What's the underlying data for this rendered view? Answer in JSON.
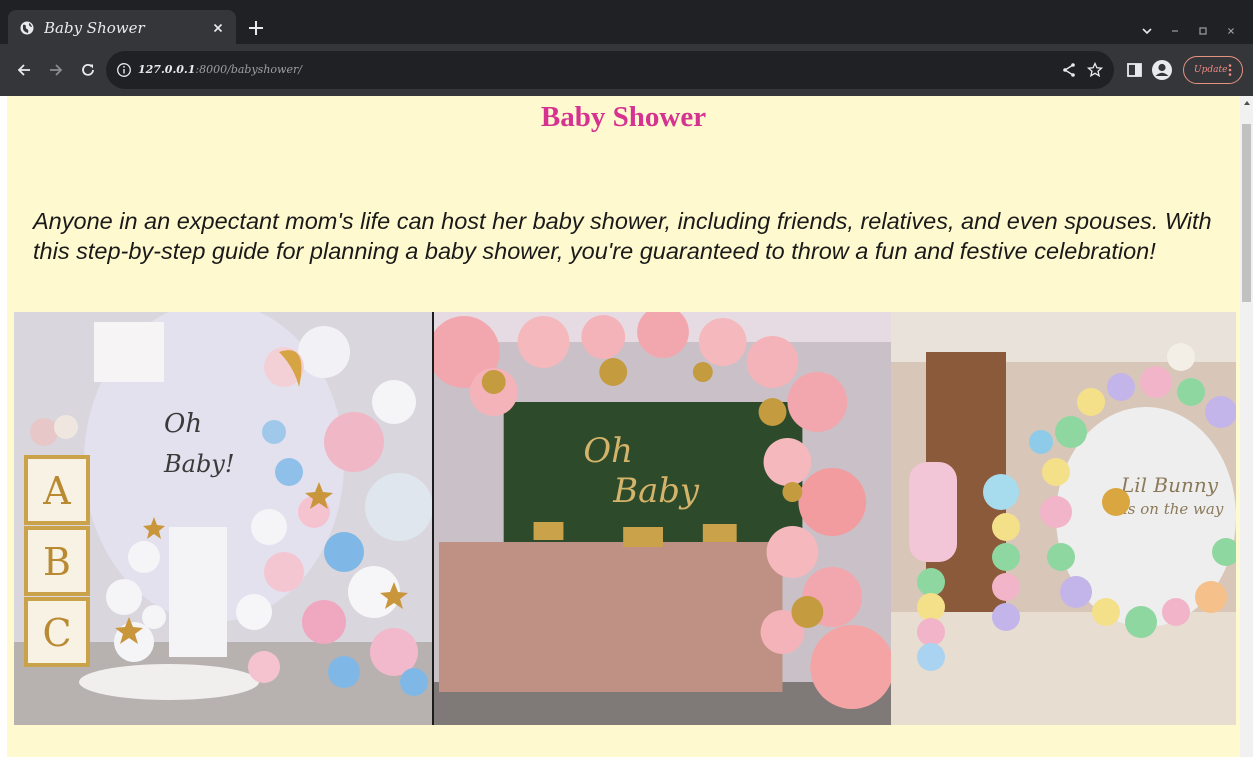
{
  "browser": {
    "tab_title": "Baby Shower",
    "url_host": "127.0.0.1",
    "url_rest": ":8000/babyshower/",
    "update_label": "Update"
  },
  "page": {
    "title": "Baby Shower",
    "intro": "Anyone in an expectant mom's life can host her baby shower, including friends, relatives, and even spouses. With this step-by-step guide for planning a baby shower, you're guaranteed to throw a fun and festive celebration!",
    "gallery": [
      {
        "sign_text_1": "Oh",
        "sign_text_2": "Baby!",
        "blocks": [
          "A",
          "B",
          "C"
        ]
      },
      {
        "sign_text_1": "Oh",
        "sign_text_2": "Baby"
      },
      {
        "sign_text_1": "Lil Bunny",
        "sign_text_2": "is on the way"
      }
    ]
  },
  "colors": {
    "page_bg": "#fff9cf",
    "title": "#d63391",
    "chrome_dark": "#202124",
    "chrome_toolbar": "#35363a"
  }
}
